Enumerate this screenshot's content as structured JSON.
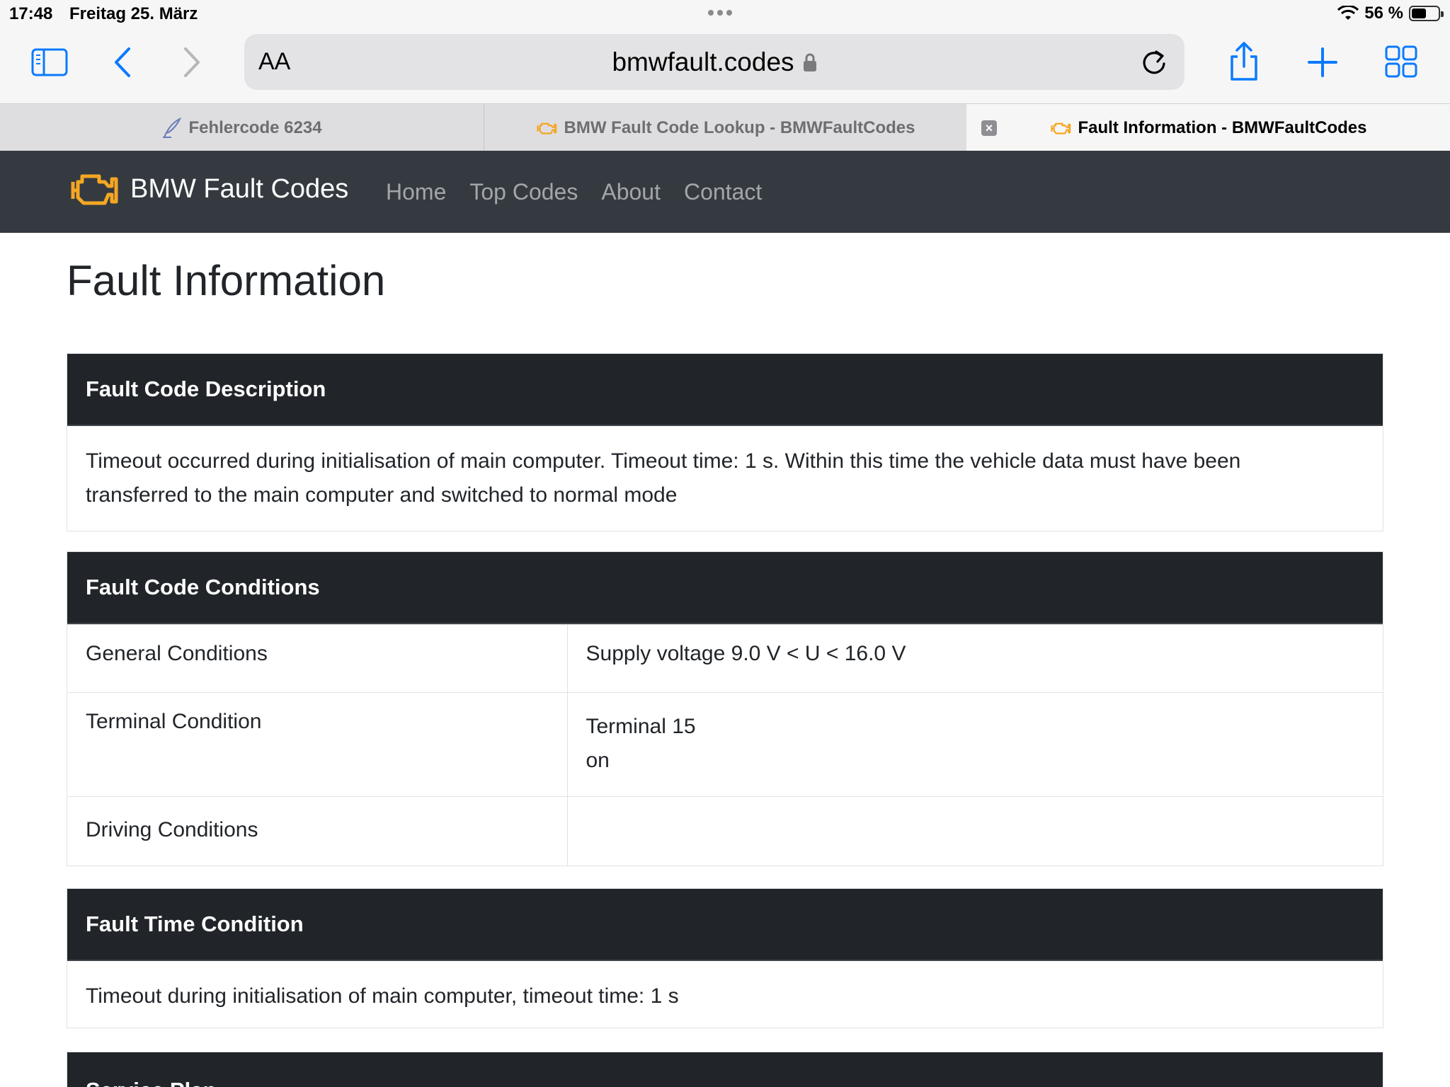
{
  "status": {
    "time": "17:48",
    "date": "Freitag 25. März",
    "battery": "56 %",
    "battery_level": 0.56
  },
  "address": {
    "text_size_label": "AA",
    "url": "bmwfault.codes"
  },
  "tabs": [
    {
      "label": "Fehlercode 6234",
      "active": false
    },
    {
      "label": "BMW Fault Code Lookup - BMWFaultCodes",
      "active": false
    },
    {
      "label": "Fault Information - BMWFaultCodes",
      "active": true
    }
  ],
  "site": {
    "brand": "BMW Fault Codes",
    "brand_color": "#f5a623",
    "nav": [
      "Home",
      "Top Codes",
      "About",
      "Contact"
    ]
  },
  "page": {
    "title": "Fault Information",
    "description": {
      "header": "Fault Code Description",
      "line1": "Timeout occurred during initialisation of main computer. Timeout time: 1 s. Within this time the vehicle data must have been",
      "line2": "transferred to the main computer and switched to normal mode"
    },
    "conditions": {
      "header": "Fault Code Conditions",
      "rows": [
        {
          "label": "General Conditions",
          "value_line1": "Supply voltage 9.0 V < U < 16.0 V",
          "value_line2": ""
        },
        {
          "label": "Terminal Condition",
          "value_line1": "Terminal 15",
          "value_line2": "on"
        },
        {
          "label": "Driving Conditions",
          "value_line1": "",
          "value_line2": ""
        }
      ]
    },
    "time_condition": {
      "header": "Fault Time Condition",
      "text": "Timeout during initialisation of main computer, timeout time: 1 s"
    },
    "service_plan": {
      "header": "Service Plan"
    }
  }
}
